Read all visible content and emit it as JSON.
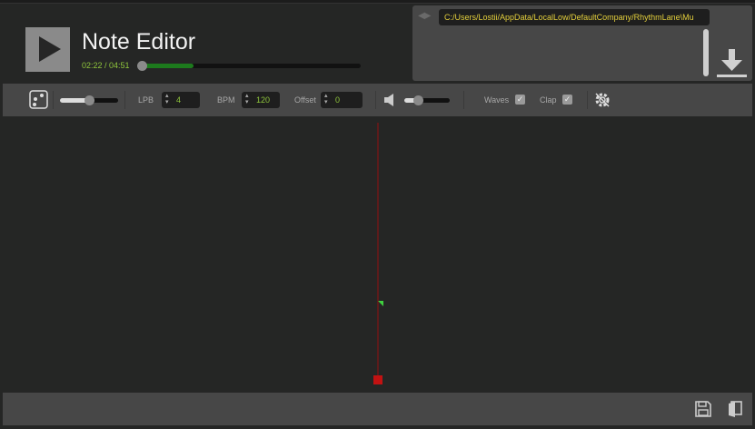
{
  "header": {
    "title": "Note Editor",
    "time": "02:22 / 04:51",
    "progress_fraction": 0.25
  },
  "file_browser": {
    "path": "C:/Users/Lostii/AppData/LocalLow/DefaultCompany/RhythmLane\\Mu"
  },
  "toolbar": {
    "zoom_fraction": 0.5,
    "lpb_label": "LPB",
    "lpb_value": "4",
    "bpm_label": "BPM",
    "bpm_value": "120",
    "offset_label": "Offset",
    "offset_value": "0",
    "volume_fraction": 0.3,
    "waves_label": "Waves",
    "waves_checked": true,
    "clap_label": "Clap",
    "clap_checked": true
  },
  "colors": {
    "accent_green": "#8fc63c",
    "path_yellow": "#e3cf3c",
    "cursor_red": "#c21212"
  }
}
